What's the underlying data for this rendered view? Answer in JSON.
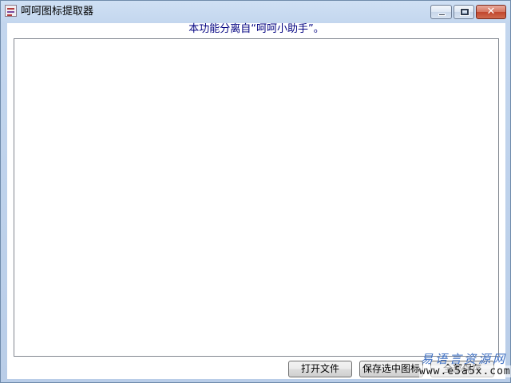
{
  "window": {
    "title": "呵呵图标提取器",
    "icon": "app-icon",
    "controls": {
      "minimize_icon": "minimize-icon",
      "maximize_icon": "maximize-icon",
      "close_glyph": "✕"
    }
  },
  "main": {
    "notice": "本功能分离自“呵呵小助手”。",
    "icon_list": {
      "items": []
    }
  },
  "buttons": {
    "open_file": "打开文件",
    "save_selected": "保存选中图标",
    "save_all": "全部保存"
  },
  "watermark": {
    "site_name": "易语言资源网",
    "url": "www.e5a5x.com"
  }
}
